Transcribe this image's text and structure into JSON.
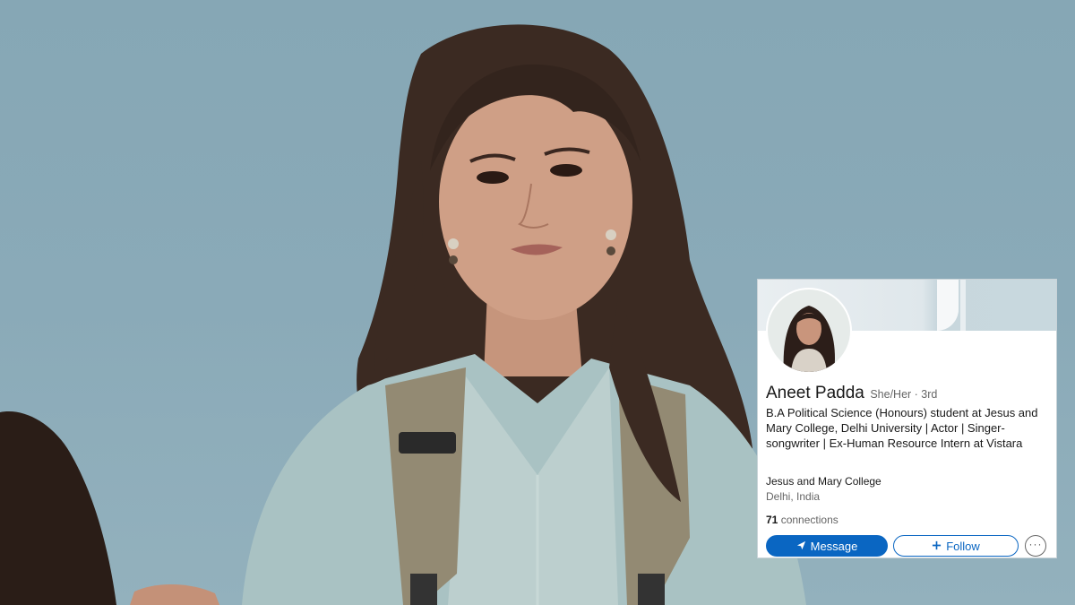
{
  "colors": {
    "sky": "#8aaab8",
    "linkedin_blue": "#0a66c2",
    "text_primary": "#191919",
    "text_secondary": "#666666"
  },
  "profile_card": {
    "name": "Aneet Padda",
    "pronouns_degree": "She/Her · 3rd",
    "headline": "B.A Political Science (Honours) student at Jesus and Mary College, Delhi University | Actor | Singer-songwriter | Ex-Human Resource Intern at Vistara",
    "school": "Jesus and Mary College",
    "location": "Delhi, India",
    "connections_count": "71",
    "connections_label": "connections",
    "message_label": "Message",
    "follow_label": "Follow",
    "more_label": "···",
    "icons": {
      "message": "send-icon",
      "follow": "plus-icon",
      "more": "ellipsis-icon"
    }
  }
}
